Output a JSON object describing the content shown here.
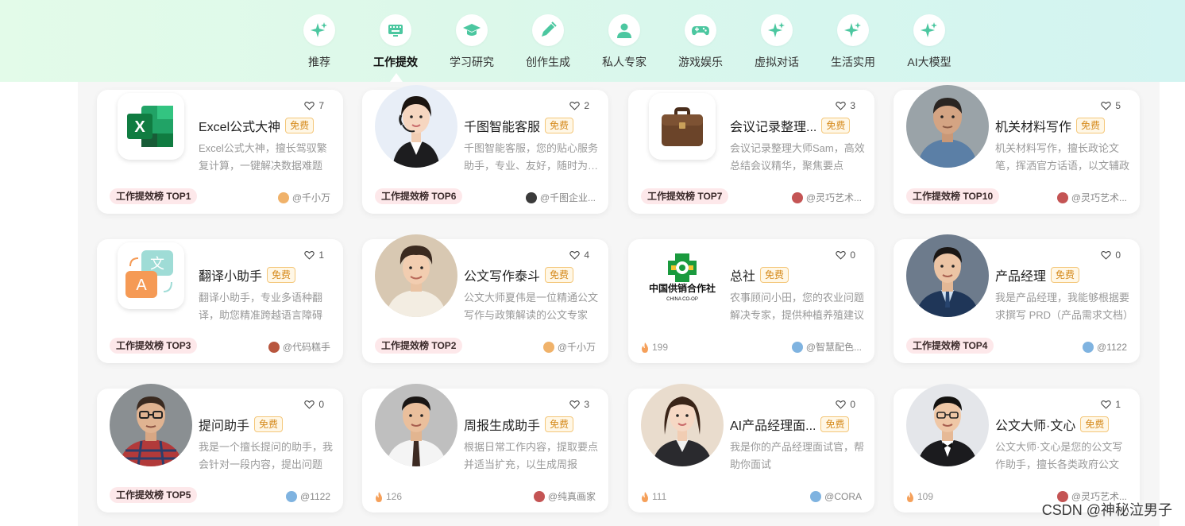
{
  "nav": {
    "items": [
      {
        "label": "推荐",
        "icon": "sparkle-icon"
      },
      {
        "label": "工作提效",
        "icon": "keyboard-icon"
      },
      {
        "label": "学习研究",
        "icon": "graduation-cap-icon"
      },
      {
        "label": "创作生成",
        "icon": "pen-icon"
      },
      {
        "label": "私人专家",
        "icon": "person-icon"
      },
      {
        "label": "游戏娱乐",
        "icon": "gamepad-icon"
      },
      {
        "label": "虚拟对话",
        "icon": "sparkle-icon"
      },
      {
        "label": "生活实用",
        "icon": "sparkle-icon"
      },
      {
        "label": "AI大模型",
        "icon": "sparkle-icon"
      }
    ],
    "active_index": 1,
    "accent_color": "#4cc7a0"
  },
  "badge_label": "免费",
  "cards": [
    {
      "title": "Excel公式大神",
      "likes": "7",
      "desc": "Excel公式大神，擅长驾驭繁复计算，一键解决数据难题",
      "rank": "工作提效榜 TOP1",
      "author": "@千小万",
      "image": "excel-logo"
    },
    {
      "title": "千图智能客服",
      "likes": "2",
      "desc": "千图智能客服，您的贴心服务助手，专业、友好，随时为您解答",
      "rank": "工作提效榜 TOP6",
      "author": "@千图企业...",
      "image": "customer-service-photo"
    },
    {
      "title": "会议记录整理...",
      "likes": "3",
      "desc": "会议记录整理大师Sam，高效总结会议精华，聚焦要点",
      "rank": "工作提效榜 TOP7",
      "author": "@灵巧艺术...",
      "image": "briefcase-icon"
    },
    {
      "title": "机关材料写作",
      "likes": "5",
      "desc": "机关材料写作，擅长政论文笔，挥洒官方话语，以文辅政",
      "rank": "工作提效榜 TOP10",
      "author": "@灵巧艺术...",
      "image": "official-photo"
    },
    {
      "title": "翻译小助手",
      "likes": "1",
      "desc": "翻译小助手，专业多语种翻译，助您精准跨越语言障碍",
      "rank": "工作提效榜 TOP3",
      "author": "@代码糕手",
      "image": "translate-icon"
    },
    {
      "title": "公文写作泰斗",
      "likes": "4",
      "desc": "公文大师夏伟是一位精通公文写作与政策解读的公文专家",
      "rank": "工作提效榜 TOP2",
      "author": "@千小万",
      "image": "young-man-photo"
    },
    {
      "title": "总社",
      "likes": "0",
      "desc": "农事顾问小田，您的农业问题解决专家，提供种植养殖建议",
      "uses": "199",
      "author": "@智慧配色...",
      "image": "coop-logo"
    },
    {
      "title": "产品经理",
      "likes": "0",
      "desc": "我是产品经理，我能够根据要求撰写 PRD（产品需求文档）",
      "rank": "工作提效榜 TOP4",
      "author": "@1122",
      "image": "suit-man-photo"
    },
    {
      "title": "提问助手",
      "likes": "0",
      "desc": "我是一个擅长提问的助手，我会针对一段内容，提出问题",
      "rank": "工作提效榜 TOP5",
      "author": "@1122",
      "image": "glasses-man-photo"
    },
    {
      "title": "周报生成助手",
      "likes": "3",
      "desc": "根据日常工作内容，提取要点并适当扩充，以生成周报",
      "uses": "126",
      "author": "@纯真画家",
      "image": "tie-man-photo"
    },
    {
      "title": "AI产品经理面...",
      "likes": "0",
      "desc": "我是你的产品经理面试官，帮助你面试",
      "uses": "111",
      "author": "@CORA",
      "image": "woman-photo"
    },
    {
      "title": "公文大师·文心",
      "likes": "1",
      "desc": "公文大师·文心是您的公文写作助手，擅长各类政府公文",
      "uses": "109",
      "author": "@灵巧艺术...",
      "image": "bowtie-man-photo"
    }
  ],
  "watermark": "CSDN @神秘泣男子"
}
